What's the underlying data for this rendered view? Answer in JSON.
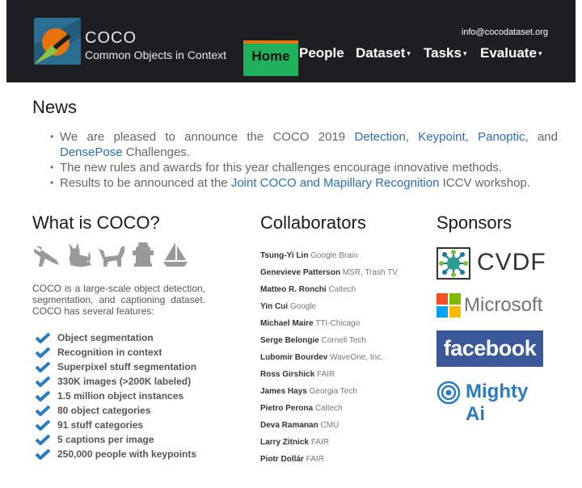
{
  "header": {
    "logo_title": "COCO",
    "logo_subtitle": "Common Objects in Context",
    "email": "info@cocodataset.org",
    "nav": [
      {
        "label": "Home",
        "active": true
      },
      {
        "label": "People"
      },
      {
        "label": "Dataset",
        "dropdown": true
      },
      {
        "label": "Tasks",
        "dropdown": true
      },
      {
        "label": "Evaluate",
        "dropdown": true
      }
    ],
    "caret": "▾"
  },
  "news": {
    "title": "News",
    "item1": {
      "prefix": "We are pleased to announce the COCO 2019 ",
      "link1": "Detection",
      "sep1": ", ",
      "link2": "Keypoint",
      "sep2": ", ",
      "link3": "Panoptic",
      "sep3": ", and ",
      "link4": "DensePose",
      "suffix": " Challenges."
    },
    "item2": "The new rules and awards for this year challenges encourage innovative methods.",
    "item3": {
      "prefix": "Results to be announced at the ",
      "link": "Joint COCO and Mapillary Recognition",
      "suffix": " ICCV workshop."
    }
  },
  "what": {
    "title": "What is COCO?",
    "category_icons": [
      "airplane-icon",
      "cat-icon",
      "dog-icon",
      "fire-hydrant-icon",
      "sailboat-icon"
    ],
    "description": "COCO is a large-scale object detection, segmentation, and captioning dataset. COCO has several features:",
    "features": [
      "Object segmentation",
      "Recognition in context",
      "Superpixel stuff segmentation",
      "330K images (>200K labeled)",
      "1.5 million object instances",
      "80 object categories",
      "91 stuff categories",
      "5 captions per image",
      "250,000 people with keypoints"
    ]
  },
  "collaborators": {
    "title": "Collaborators",
    "people": [
      {
        "name": "Tsung-Yi Lin",
        "affiliation": "Google Brain"
      },
      {
        "name": "Genevieve Patterson",
        "affiliation": "MSR, Trash TV"
      },
      {
        "name": "Matteo R. Ronchi",
        "affiliation": "Caltech"
      },
      {
        "name": "Yin Cui",
        "affiliation": "Google"
      },
      {
        "name": "Michael Maire",
        "affiliation": "TTI-Chicago"
      },
      {
        "name": "Serge Belongie",
        "affiliation": "Cornell Tech"
      },
      {
        "name": "Lubomir Bourdev",
        "affiliation": "WaveOne, Inc."
      },
      {
        "name": "Ross Girshick",
        "affiliation": "FAIR"
      },
      {
        "name": "James Hays",
        "affiliation": "Georgia Tech"
      },
      {
        "name": "Pietro Perona",
        "affiliation": "Caltech"
      },
      {
        "name": "Deva Ramanan",
        "affiliation": "CMU"
      },
      {
        "name": "Larry Zitnick",
        "affiliation": "FAIR"
      },
      {
        "name": "Piotr Dollár",
        "affiliation": "FAIR"
      }
    ]
  },
  "sponsors": {
    "title": "Sponsors",
    "cvdf": "CVDF",
    "microsoft": "Microsoft",
    "facebook": "facebook",
    "mighty_ai": "Mighty Ai"
  },
  "colors": {
    "header_bg": "#1c1e22",
    "nav_active": "#1fb15b",
    "nav_active_border": "#e8720c",
    "link": "#2a6ebb",
    "check": "#2b7bc0",
    "facebook": "#3b5998",
    "mighty_ai": "#2b7bc0"
  }
}
